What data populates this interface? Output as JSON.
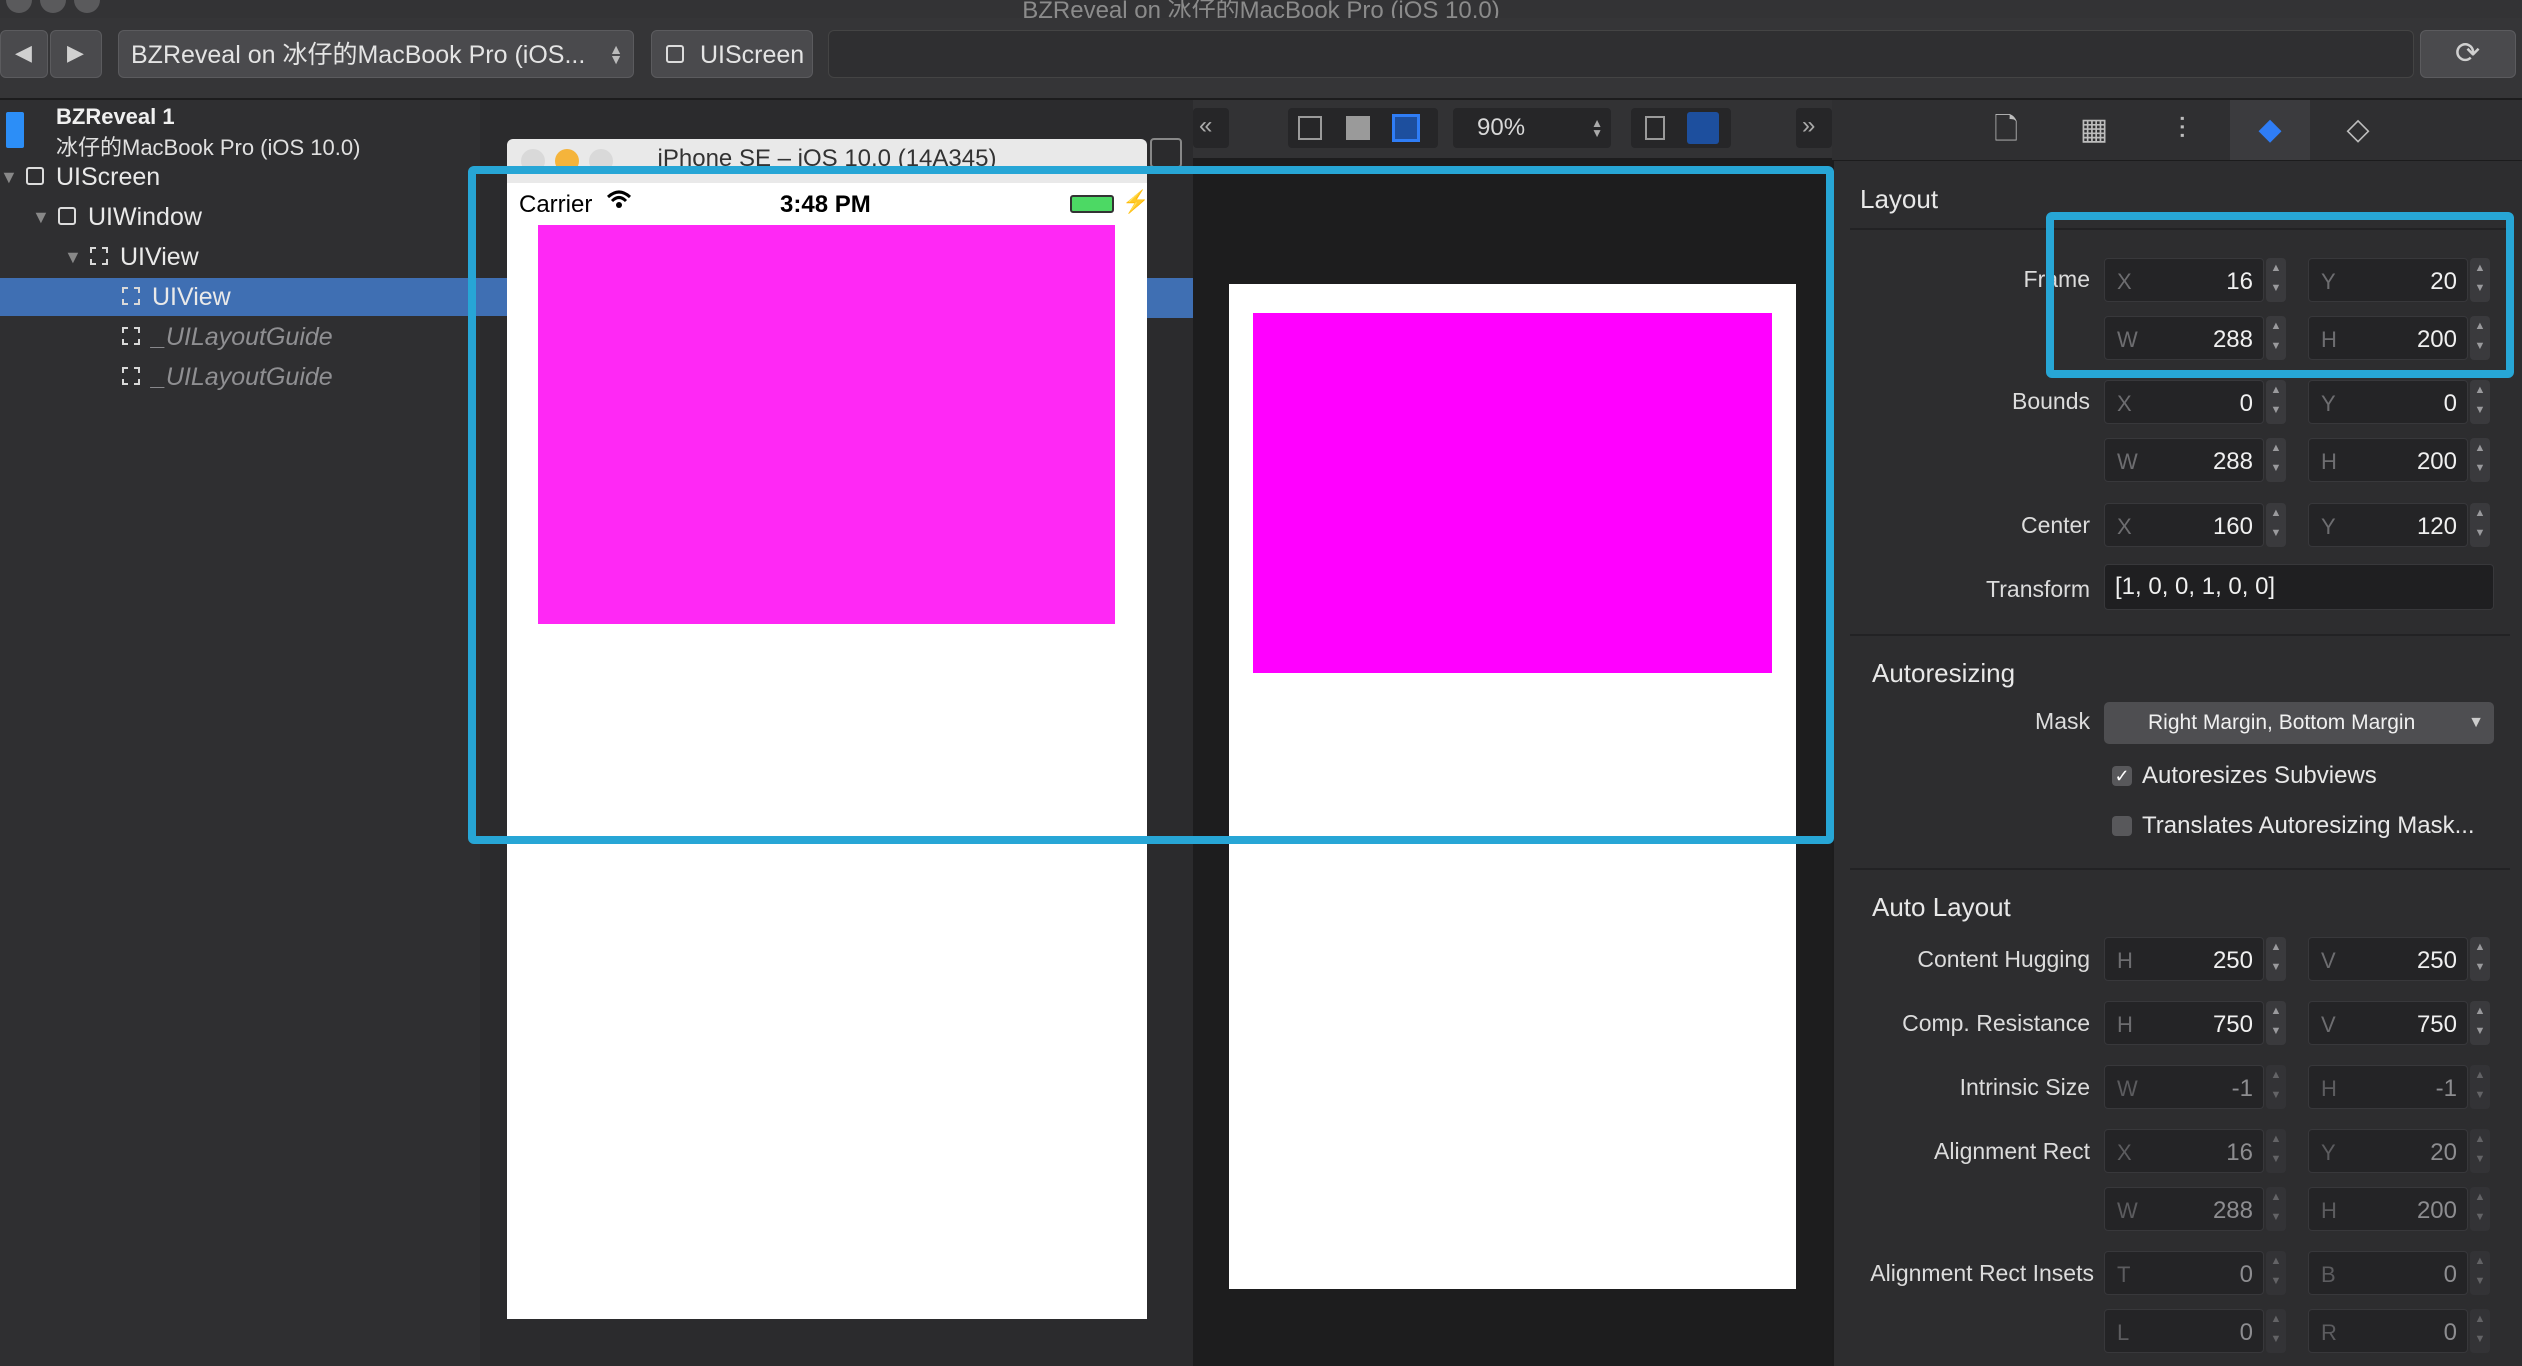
{
  "window": {
    "title": "BZReveal on 冰仔的MacBook Pro (iOS 10.0)"
  },
  "toolbar": {
    "back_icon": "chevron-left-icon",
    "forward_icon": "chevron-right-icon",
    "device_select": "BZReveal on 冰仔的MacBook Pro (iOS...",
    "breadcrumb": "UIScreen",
    "refresh_icon": "refresh-icon"
  },
  "app": {
    "name": "BZReveal 1",
    "device": "冰仔的MacBook Pro (iOS 10.0)"
  },
  "hierarchy": [
    {
      "label": "UIScreen",
      "indent": 0,
      "expanded": true,
      "icon": "solid",
      "selected": false,
      "guide": false
    },
    {
      "label": "UIWindow",
      "indent": 1,
      "expanded": true,
      "icon": "solid",
      "selected": false,
      "guide": false
    },
    {
      "label": "UIView",
      "indent": 2,
      "expanded": true,
      "icon": "dashed",
      "selected": false,
      "guide": false
    },
    {
      "label": "UIView",
      "indent": 3,
      "expanded": false,
      "icon": "dashed",
      "selected": true,
      "guide": false
    },
    {
      "label": "_UILayoutGuide",
      "indent": 3,
      "expanded": false,
      "icon": "dashed",
      "selected": false,
      "guide": true
    },
    {
      "label": "_UILayoutGuide",
      "indent": 3,
      "expanded": false,
      "icon": "dashed",
      "selected": false,
      "guide": true
    }
  ],
  "simulator": {
    "title": "iPhone SE – iOS 10.0 (14A345)",
    "carrier": "Carrier",
    "time": "3:48 PM"
  },
  "canvas": {
    "zoom": "90%"
  },
  "inspector": {
    "layout_title": "Layout",
    "frame_label": "Frame",
    "frame": {
      "x": "16",
      "y": "20",
      "w": "288",
      "h": "200"
    },
    "bounds_label": "Bounds",
    "bounds": {
      "x": "0",
      "y": "0",
      "w": "288",
      "h": "200"
    },
    "center_label": "Center",
    "center": {
      "x": "160",
      "y": "120"
    },
    "transform_label": "Transform",
    "transform": "[1, 0, 0, 1, 0, 0]",
    "autoresizing_title": "Autoresizing",
    "mask_label": "Mask",
    "mask_value": "Right Margin, Bottom Margin",
    "autoresizes_subviews": "Autoresizes Subviews",
    "autoresizes_checked": true,
    "translates_mask": "Translates Autoresizing Mask...",
    "translates_checked": false,
    "auto_layout_title": "Auto Layout",
    "hugging_label": "Content Hugging",
    "hugging": {
      "h": "250",
      "v": "250"
    },
    "resistance_label": "Comp. Resistance",
    "resistance": {
      "h": "750",
      "v": "750"
    },
    "intrinsic_label": "Intrinsic Size",
    "intrinsic": {
      "w": "-1",
      "h": "-1"
    },
    "alignment_rect_label": "Alignment Rect",
    "alignment_rect": {
      "x": "16",
      "y": "20",
      "w": "288",
      "h": "200"
    },
    "alignment_insets_label": "Alignment Rect Insets",
    "alignment_insets": {
      "t": "0",
      "b": "0",
      "l": "0",
      "r": "0"
    }
  },
  "axes": {
    "x": "X",
    "y": "Y",
    "w": "W",
    "h": "H",
    "v": "V",
    "t": "T",
    "b": "B",
    "l": "L",
    "r": "R"
  },
  "colors": {
    "highlight": "#27a6d6",
    "magenta": "#ff00ff",
    "selection": "#3f6fb3",
    "active_tab": "#2f7df6"
  }
}
